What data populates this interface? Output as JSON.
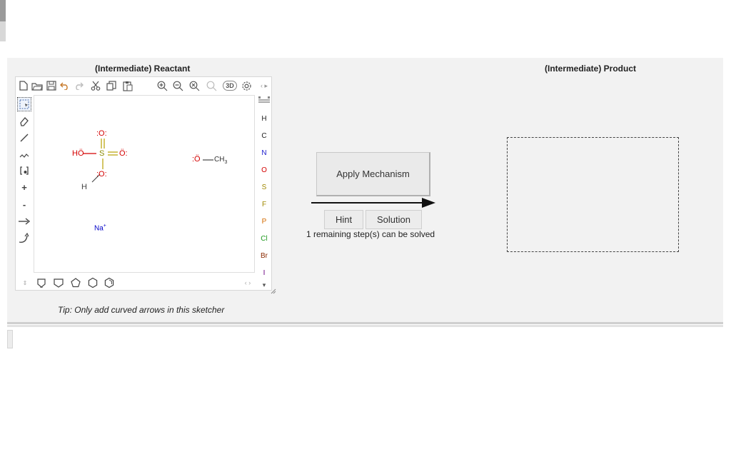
{
  "reactant_heading": "(Intermediate) Reactant",
  "product_heading": "(Intermediate) Product",
  "toolbar": {
    "new": "new-document-icon",
    "open": "open-icon",
    "save": "save-icon",
    "undo": "undo-icon",
    "redo": "redo-icon",
    "cut": "cut-icon",
    "copy": "copy-icon",
    "paste": "paste-icon",
    "zoom_in": "zoom-in-icon",
    "zoom_out": "zoom-out-icon",
    "zoom_reset": "zoom-reset-icon",
    "zoom_fit": "zoom-fit-icon",
    "three_d": "3D",
    "settings": "settings-icon"
  },
  "left_tools": {
    "charge_plus": "+",
    "charge_minus": "-"
  },
  "elements": [
    "H",
    "C",
    "N",
    "O",
    "S",
    "F",
    "P",
    "Cl",
    "Br",
    "I"
  ],
  "element_colors": {
    "H": "#222222",
    "C": "#222222",
    "N": "#1a1acc",
    "O": "#d40000",
    "S": "#a08800",
    "F": "#a08800",
    "P": "#d46a00",
    "Cl": "#1f9a1f",
    "Br": "#8b2a00",
    "I": "#6a0080"
  },
  "molecule": {
    "top_oxygen": ":O:",
    "ho": "HÖ",
    "sulfur": "S",
    "right_oxygen": "Ö:",
    "bottom_oxygen": ":O:",
    "h": "H",
    "methanol_oxygen": ":Ö",
    "methyl": "CH",
    "methyl_sub": "3",
    "sodium": "Na",
    "sodium_charge": "+"
  },
  "tip": "Tip: Only add curved arrows in this sketcher",
  "apply_label": "Apply Mechanism",
  "hint_label": "Hint",
  "solution_label": "Solution",
  "remaining_text": "1 remaining step(s) can be solved"
}
